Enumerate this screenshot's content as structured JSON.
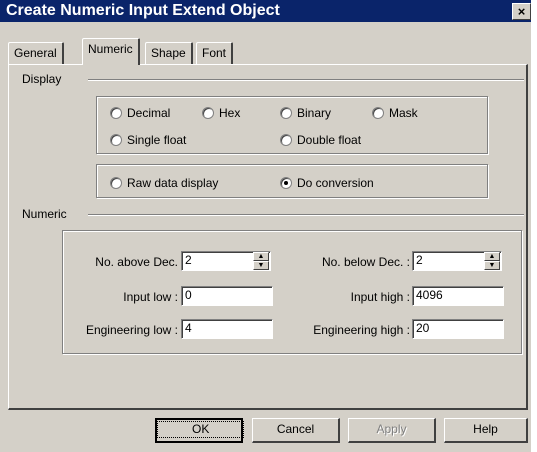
{
  "window": {
    "title": "Create Numeric Input Extend  Object",
    "close_glyph": "×"
  },
  "tabs": [
    {
      "label": "General",
      "active": false
    },
    {
      "label": "Numeric",
      "active": true
    },
    {
      "label": "Shape",
      "active": false
    },
    {
      "label": "Font",
      "active": false
    }
  ],
  "display": {
    "section_label": "Display",
    "format_options": [
      {
        "label": "Decimal",
        "checked": false
      },
      {
        "label": "Hex",
        "checked": false
      },
      {
        "label": "Binary",
        "checked": false
      },
      {
        "label": "Mask",
        "checked": false
      },
      {
        "label": "Single float",
        "checked": false
      },
      {
        "label": "Double float",
        "checked": false
      }
    ],
    "conversion_options": [
      {
        "label": "Raw data display",
        "checked": false
      },
      {
        "label": "Do conversion",
        "checked": true
      }
    ]
  },
  "numeric": {
    "section_label": "Numeric",
    "no_above_dec": {
      "label": "No. above Dec.",
      "value": "2"
    },
    "no_below_dec": {
      "label": "No. below Dec. :",
      "value": "2"
    },
    "input_low": {
      "label": "Input low :",
      "value": "0"
    },
    "input_high": {
      "label": "Input high :",
      "value": "4096"
    },
    "engineering_low": {
      "label": "Engineering low :",
      "value": "4"
    },
    "engineering_high": {
      "label": "Engineering high :",
      "value": "20"
    }
  },
  "buttons": {
    "ok": "OK",
    "cancel": "Cancel",
    "apply": "Apply",
    "help": "Help"
  }
}
